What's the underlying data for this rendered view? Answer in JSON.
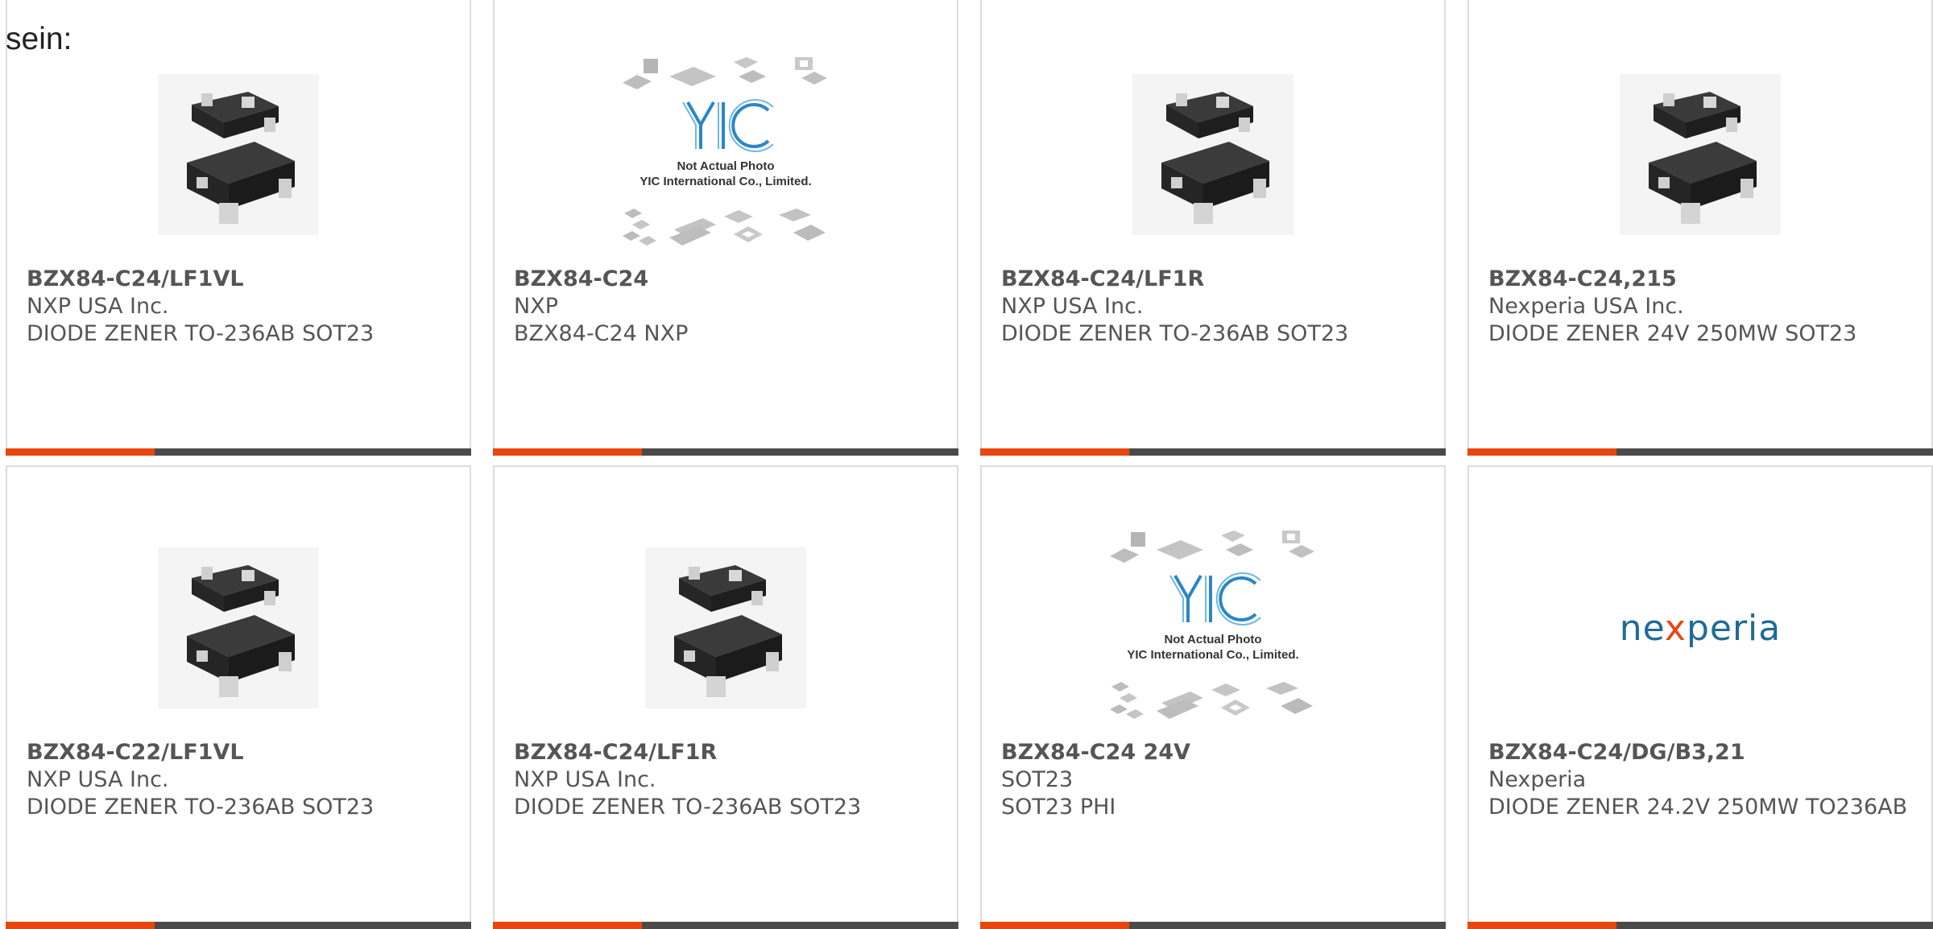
{
  "intro_text": "sein:",
  "colors": {
    "accent": "#e8460f",
    "bar": "#4a4a4a",
    "border": "#dcdcdc",
    "nexperia_blue": "#1f6b96",
    "nexperia_orange": "#e8460f"
  },
  "products": [
    {
      "part_number": "BZX84-C24/LF1VL",
      "manufacturer": "NXP USA Inc.",
      "description": "DIODE ZENER TO-236AB SOT23",
      "image": "sot23-chip"
    },
    {
      "part_number": "BZX84-C24",
      "manufacturer": "NXP",
      "description": "BZX84-C24 NXP",
      "image": "yic-placeholder"
    },
    {
      "part_number": "BZX84-C24/LF1R",
      "manufacturer": "NXP USA Inc.",
      "description": "DIODE ZENER TO-236AB SOT23",
      "image": "sot23-chip"
    },
    {
      "part_number": "BZX84-C24,215",
      "manufacturer": "Nexperia USA Inc.",
      "description": "DIODE ZENER 24V 250MW SOT23",
      "image": "sot23-chip"
    },
    {
      "part_number": "BZX84-C22/LF1VL",
      "manufacturer": "NXP USA Inc.",
      "description": "DIODE ZENER TO-236AB SOT23",
      "image": "sot23-chip"
    },
    {
      "part_number": "BZX84-C24/LF1R",
      "manufacturer": "NXP USA Inc.",
      "description": "DIODE ZENER TO-236AB SOT23",
      "image": "sot23-chip"
    },
    {
      "part_number": "BZX84-C24 24V",
      "manufacturer": "SOT23",
      "description": "SOT23 PHI",
      "image": "yic-placeholder"
    },
    {
      "part_number": "BZX84-C24/DG/B3,21",
      "manufacturer": "Nexperia",
      "description": "DIODE ZENER 24.2V 250MW TO236AB",
      "image": "nexperia-logo"
    }
  ],
  "yic_placeholder": {
    "line1": "Not Actual Photo",
    "line2": "YIC International Co., Limited."
  },
  "nexperia_logo": {
    "prefix": "ne",
    "x": "x",
    "suffix": "peria"
  }
}
